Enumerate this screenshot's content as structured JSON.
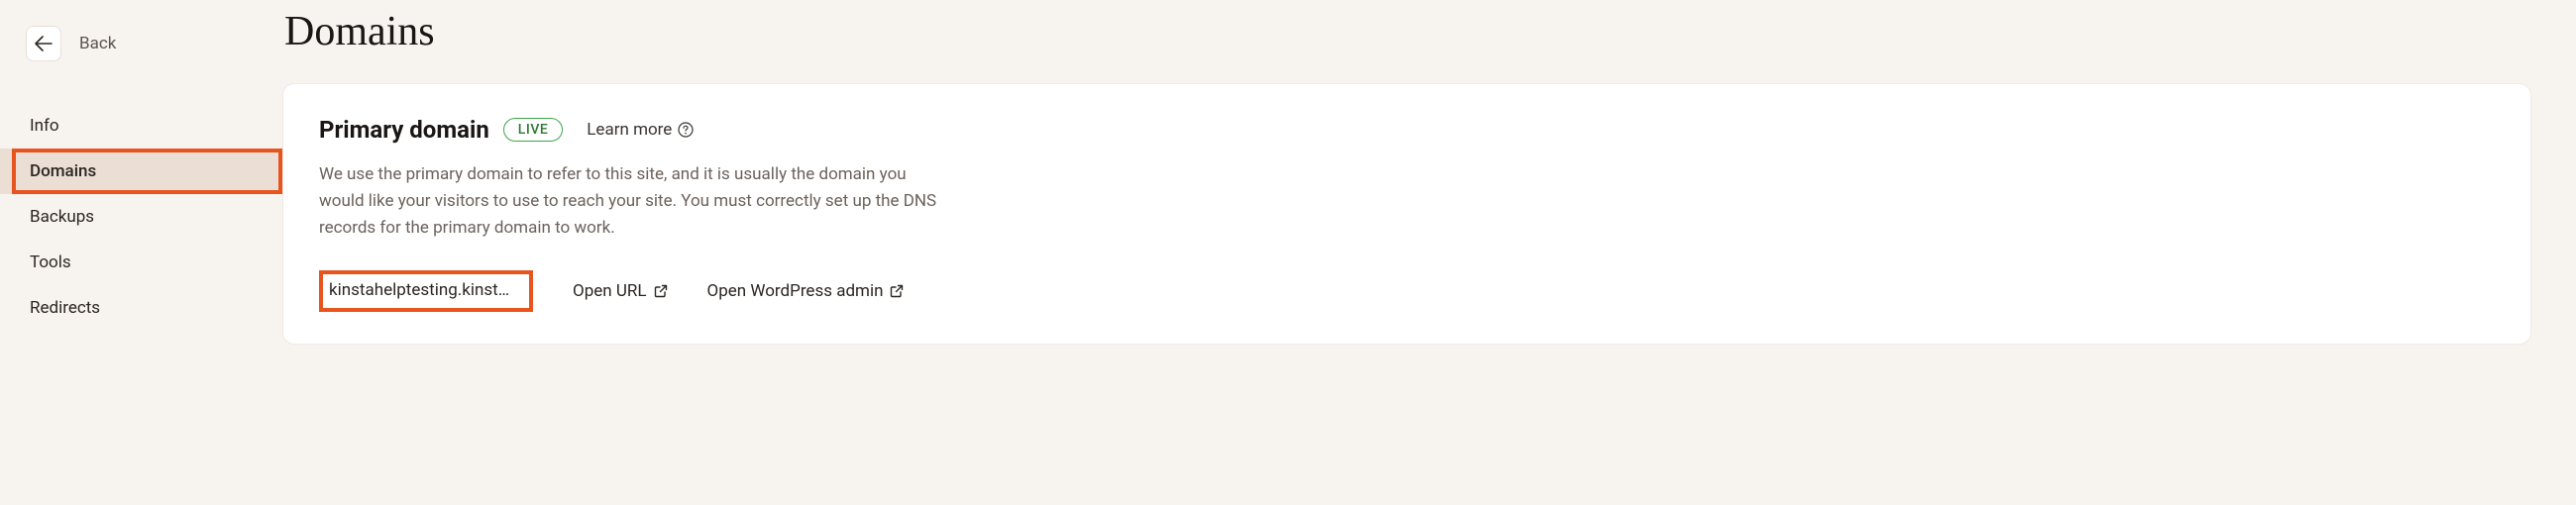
{
  "back": {
    "label": "Back"
  },
  "sidebar": {
    "items": [
      {
        "label": "Info"
      },
      {
        "label": "Domains"
      },
      {
        "label": "Backups"
      },
      {
        "label": "Tools"
      },
      {
        "label": "Redirects"
      }
    ],
    "active_index": 1
  },
  "page": {
    "title": "Domains"
  },
  "primary_domain": {
    "heading": "Primary domain",
    "badge": "LIVE",
    "learn_more": "Learn more",
    "description": "We use the primary domain to refer to this site, and it is usually the domain you would like your visitors to use to reach your site. You must correctly set up the DNS records for the primary domain to work.",
    "domain": "kinstahelptesting.kinst…",
    "open_url": "Open URL",
    "open_wp_admin": "Open WordPress admin"
  }
}
